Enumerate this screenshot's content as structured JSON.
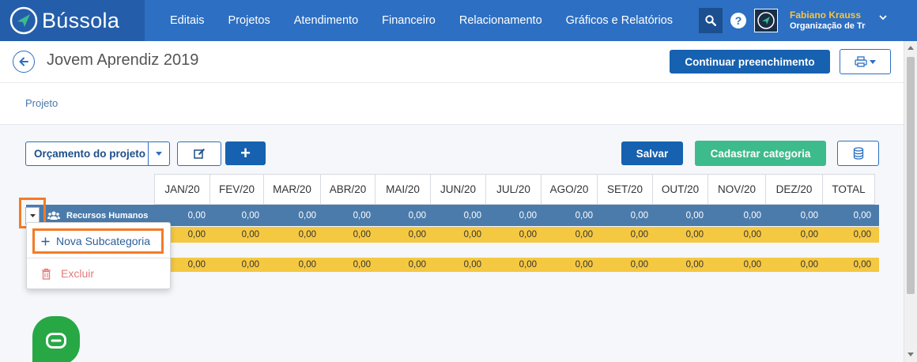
{
  "app": {
    "brand": "Bússola"
  },
  "nav": {
    "items": [
      "Editais",
      "Projetos",
      "Atendimento",
      "Financeiro",
      "Relacionamento",
      "Gráficos e Relatórios"
    ]
  },
  "user": {
    "name": "Fabiano Krauss",
    "org": "Organização de Tre"
  },
  "header": {
    "title": "Jovem Aprendiz 2019",
    "continue_label": "Continuar preenchimento"
  },
  "breadcrumb": "Projeto",
  "toolbar": {
    "budget_label": "Orçamento do projeto",
    "add_label": "+",
    "save_label": "Salvar",
    "category_label": "Cadastrar categoria"
  },
  "table": {
    "columns": [
      "JAN/20",
      "FEV/20",
      "MAR/20",
      "ABR/20",
      "MAI/20",
      "JUN/20",
      "JUL/20",
      "AGO/20",
      "SET/20",
      "OUT/20",
      "NOV/20",
      "DEZ/20",
      "TOTAL"
    ],
    "rows": [
      {
        "label": "Recursos Humanos",
        "values": [
          "0,00",
          "0,00",
          "0,00",
          "0,00",
          "0,00",
          "0,00",
          "0,00",
          "0,00",
          "0,00",
          "0,00",
          "0,00",
          "0,00",
          "0,00"
        ]
      },
      {
        "label": "",
        "values": [
          "0,00",
          "0,00",
          "0,00",
          "0,00",
          "0,00",
          "0,00",
          "0,00",
          "0,00",
          "0,00",
          "0,00",
          "0,00",
          "0,00",
          "0,00"
        ]
      },
      {
        "label": "",
        "values": [
          "0,00",
          "0,00",
          "0,00",
          "0,00",
          "0,00",
          "0,00",
          "0,00",
          "0,00",
          "0,00",
          "0,00",
          "0,00",
          "0,00",
          "0,00"
        ]
      }
    ]
  },
  "menu": {
    "new_subcategory": "Nova Subcategoria",
    "delete": "Excluir"
  },
  "colors": {
    "nav": "#2d6fc2",
    "brand_bg": "#245eaa",
    "primary": "#1661b0",
    "success": "#3dbb8c",
    "row_header": "#4b7bab",
    "row_yellow": "#f5c842",
    "highlight": "#f47b26",
    "chat": "#27a845"
  }
}
